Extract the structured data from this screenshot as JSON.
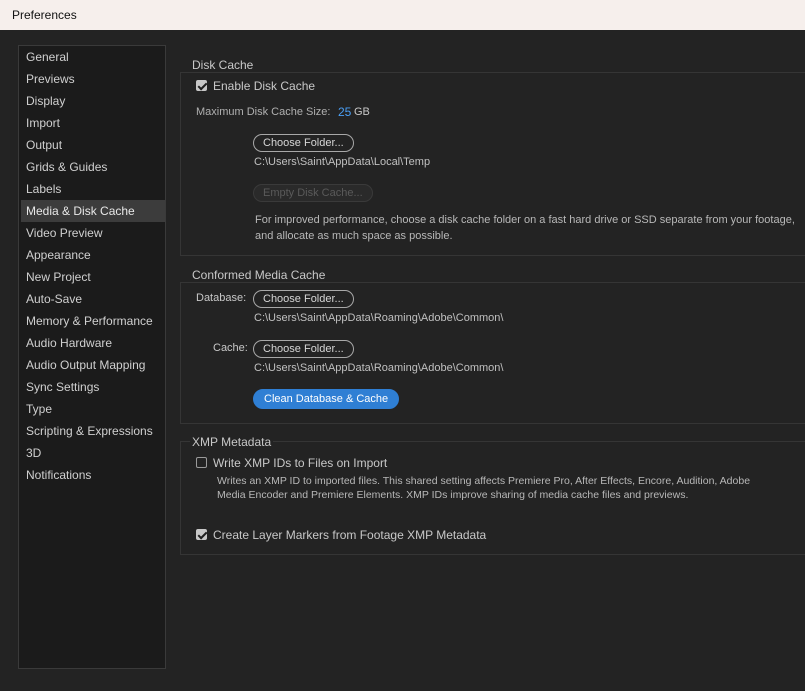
{
  "window": {
    "title": "Preferences"
  },
  "sidebar": {
    "items": [
      {
        "label": "General"
      },
      {
        "label": "Previews"
      },
      {
        "label": "Display"
      },
      {
        "label": "Import"
      },
      {
        "label": "Output"
      },
      {
        "label": "Grids & Guides"
      },
      {
        "label": "Labels"
      },
      {
        "label": "Media & Disk Cache",
        "selected": true
      },
      {
        "label": "Video Preview"
      },
      {
        "label": "Appearance"
      },
      {
        "label": "New Project"
      },
      {
        "label": "Auto-Save"
      },
      {
        "label": "Memory & Performance"
      },
      {
        "label": "Audio Hardware"
      },
      {
        "label": "Audio Output Mapping"
      },
      {
        "label": "Sync Settings"
      },
      {
        "label": "Type"
      },
      {
        "label": "Scripting & Expressions"
      },
      {
        "label": "3D"
      },
      {
        "label": "Notifications"
      }
    ]
  },
  "disk_cache": {
    "legend": "Disk Cache",
    "enable_label": "Enable Disk Cache",
    "enable_checked": true,
    "max_size_label": "Maximum Disk Cache Size:",
    "max_size_value": "25",
    "max_size_unit": "GB",
    "choose_folder_label": "Choose Folder...",
    "folder_path": "C:\\Users\\Saint\\AppData\\Local\\Temp",
    "empty_label": "Empty Disk Cache...",
    "help_text": "For improved performance, choose a disk cache folder on a fast hard drive or SSD separate from your footage, and allocate as much space as possible."
  },
  "conformed_cache": {
    "legend": "Conformed Media Cache",
    "database_label": "Database:",
    "database_button": "Choose Folder...",
    "database_path": "C:\\Users\\Saint\\AppData\\Roaming\\Adobe\\Common\\",
    "cache_label": "Cache:",
    "cache_button": "Choose Folder...",
    "cache_path": "C:\\Users\\Saint\\AppData\\Roaming\\Adobe\\Common\\",
    "clean_label": "Clean Database & Cache"
  },
  "xmp": {
    "legend": "XMP Metadata",
    "write_ids_label": "Write XMP IDs to Files on Import",
    "write_ids_checked": false,
    "write_ids_help": "Writes an XMP ID to imported files. This shared setting affects Premiere Pro, After Effects, Encore, Audition, Adobe Media Encoder and Premiere Elements. XMP IDs improve sharing of media cache files and previews.",
    "layer_markers_label": "Create Layer Markers from Footage XMP Metadata",
    "layer_markers_checked": true
  },
  "colors": {
    "accent": "#2f7fd4",
    "value_blue": "#4a9ff5",
    "background": "#232323"
  }
}
